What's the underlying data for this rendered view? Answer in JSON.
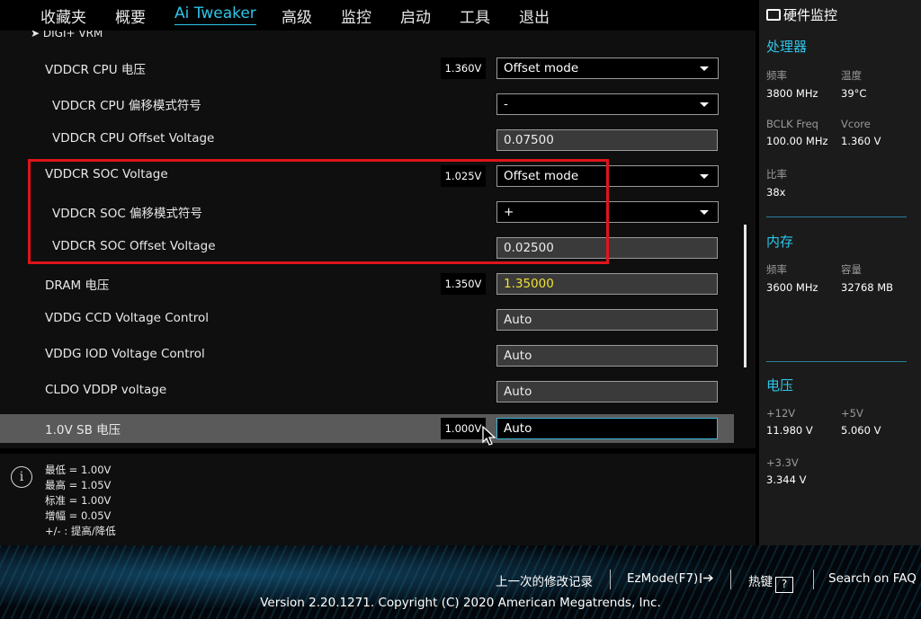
{
  "menu": {
    "tabs": [
      {
        "label": "收藏夹"
      },
      {
        "label": "概要"
      },
      {
        "label": "Ai Tweaker"
      },
      {
        "label": "高级"
      },
      {
        "label": "监控"
      },
      {
        "label": "启动"
      },
      {
        "label": "工具"
      },
      {
        "label": "退出"
      }
    ],
    "active_tab": "Ai Tweaker"
  },
  "breadcrumb": "DIGI+ VRM",
  "settings": [
    {
      "label": "VDDCR CPU 电压",
      "current": "1.360V",
      "control": "select",
      "value": "Offset mode"
    },
    {
      "label": "VDDCR CPU 偏移模式符号",
      "control": "select",
      "value": "-"
    },
    {
      "label": "VDDCR CPU Offset Voltage",
      "control": "field",
      "value": "0.07500"
    },
    {
      "label": "VDDCR SOC Voltage",
      "current": "1.025V",
      "control": "select",
      "value": "Offset mode"
    },
    {
      "label": "VDDCR SOC 偏移模式符号",
      "control": "select",
      "value": "+"
    },
    {
      "label": "VDDCR SOC Offset Voltage",
      "control": "field",
      "value": "0.02500"
    },
    {
      "label": "DRAM 电压",
      "current": "1.350V",
      "control": "field",
      "value": "1.35000",
      "value_color": "#f0e034"
    },
    {
      "label": "VDDG CCD Voltage Control",
      "control": "field",
      "value": "Auto"
    },
    {
      "label": "VDDG IOD Voltage Control",
      "control": "field",
      "value": "Auto"
    },
    {
      "label": "CLDO VDDP voltage",
      "control": "field",
      "value": "Auto"
    },
    {
      "label": "1.0V SB 电压",
      "current": "1.000V",
      "control": "field",
      "value": "Auto",
      "selected": true
    }
  ],
  "help": {
    "lines": [
      "最低 = 1.00V",
      "最高 = 1.05V",
      "标准 = 1.00V",
      "增幅 = 0.05V",
      "+/- : 提高/降低"
    ]
  },
  "monitor": {
    "title": "硬件监控",
    "cpu": {
      "title": "处理器",
      "freq_label": "频率",
      "freq_value": "3800 MHz",
      "temp_label": "温度",
      "temp_value": "39°C",
      "bclk_label": "BCLK Freq",
      "bclk_value": "100.00 MHz",
      "vcore_label": "Vcore",
      "vcore_value": "1.360 V",
      "ratio_label": "比率",
      "ratio_value": "38x"
    },
    "memory": {
      "title": "内存",
      "freq_label": "频率",
      "freq_value": "3600 MHz",
      "cap_label": "容量",
      "cap_value": "32768 MB"
    },
    "voltage": {
      "title": "电压",
      "v12_label": "+12V",
      "v12_value": "11.980 V",
      "v5_label": "+5V",
      "v5_value": "5.060 V",
      "v33_label": "+3.3V",
      "v33_value": "3.344 V"
    }
  },
  "footer": {
    "last_changes": "上一次的修改记录",
    "ezmode": "EzMode(F7)",
    "hotkeys": "热键",
    "hotkeys_key": "?",
    "faq": "Search on FAQ",
    "version": "Version 2.20.1271. Copyright (C) 2020 American Megatrends, Inc."
  },
  "colors": {
    "accent": "#2ec5e8",
    "highlight_box": "#e0141b",
    "dram_value": "#f0e034"
  }
}
